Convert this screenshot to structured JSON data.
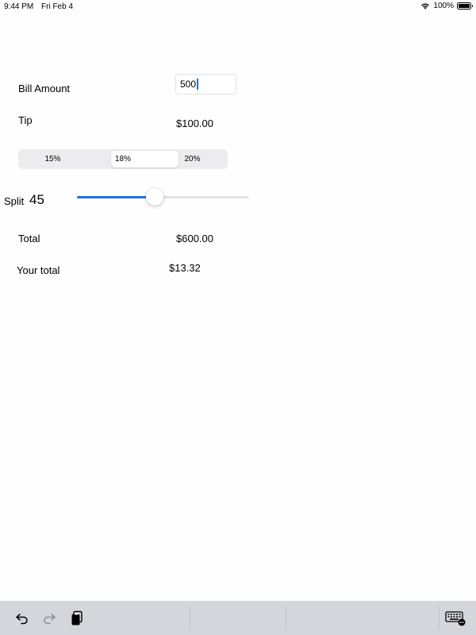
{
  "status_bar": {
    "time": "9:44 PM",
    "date": "Fri Feb 4",
    "battery": "100%"
  },
  "bill": {
    "label": "Bill Amount",
    "value": "500"
  },
  "tip": {
    "label": "Tip",
    "amount": "$100.00"
  },
  "tip_options": {
    "options": [
      "15%",
      "18%",
      "20%"
    ],
    "selected_index": 1
  },
  "split": {
    "label": "Split",
    "value": "45",
    "slider_fraction": 0.45
  },
  "total": {
    "label": "Total",
    "amount": "$600.00"
  },
  "your_total": {
    "label": "Your total",
    "amount": "$13.32"
  },
  "toolbar": {
    "icons": [
      "undo-icon",
      "redo-icon",
      "paste-icon",
      "keyboard-icon"
    ]
  },
  "colors": {
    "accent": "#1a74e8",
    "toolbar_bg": "#d5d6dc"
  }
}
